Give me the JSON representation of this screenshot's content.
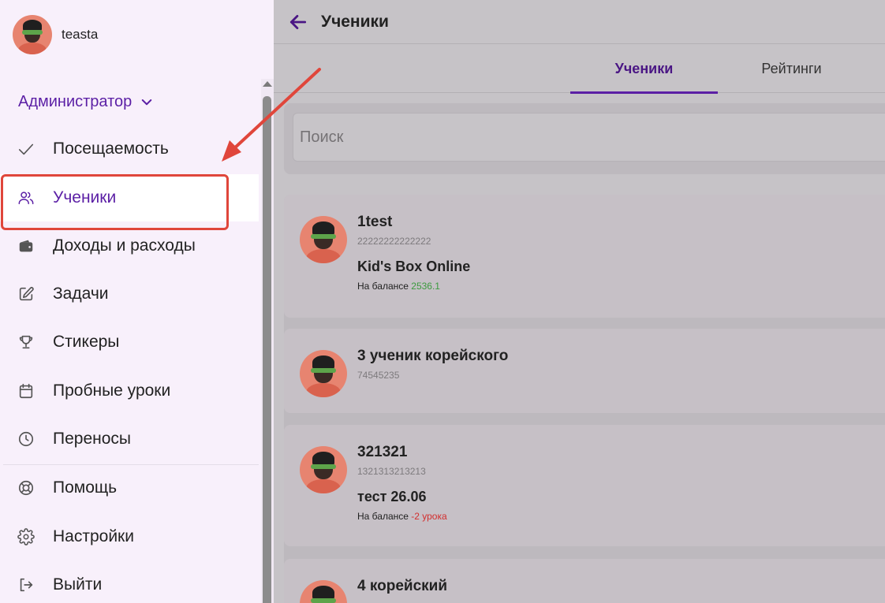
{
  "user": {
    "name": "teasta"
  },
  "sidebar": {
    "role": "Администратор",
    "items": [
      {
        "label": "Посещаемость",
        "icon": "check-icon"
      },
      {
        "label": "Ученики",
        "icon": "users-icon",
        "active": true
      },
      {
        "label": "Доходы и расходы",
        "icon": "wallet-icon"
      },
      {
        "label": "Задачи",
        "icon": "edit-icon"
      },
      {
        "label": "Стикеры",
        "icon": "trophy-icon"
      },
      {
        "label": "Пробные уроки",
        "icon": "calendar-icon"
      },
      {
        "label": "Переносы",
        "icon": "clock-icon"
      },
      {
        "label": "Помощь",
        "icon": "lifebuoy-icon"
      },
      {
        "label": "Настройки",
        "icon": "gear-icon"
      },
      {
        "label": "Выйти",
        "icon": "logout-icon"
      }
    ]
  },
  "header": {
    "title": "Ученики"
  },
  "tabs": [
    {
      "label": "Ученики",
      "active": true
    },
    {
      "label": "Рейтинги"
    }
  ],
  "search": {
    "placeholder": "Поиск"
  },
  "students": [
    {
      "name": "1test",
      "phone": "22222222222222",
      "course": "Kid's Box Online",
      "balance_label": "На балансе",
      "balance_value": "2536.1",
      "balance_sign": "pos"
    },
    {
      "name": "3 ученик корейского",
      "phone": "74545235"
    },
    {
      "name": "321321",
      "phone": "1321313213213",
      "course": "тест 26.06",
      "balance_label": "На балансе",
      "balance_value": "-2 урока",
      "balance_sign": "neg"
    },
    {
      "name": "4 корейский"
    }
  ],
  "colors": {
    "accent": "#5b1fa5",
    "annotation": "#e0463b",
    "positive": "#3b9a3e",
    "negative": "#d32f2f"
  }
}
